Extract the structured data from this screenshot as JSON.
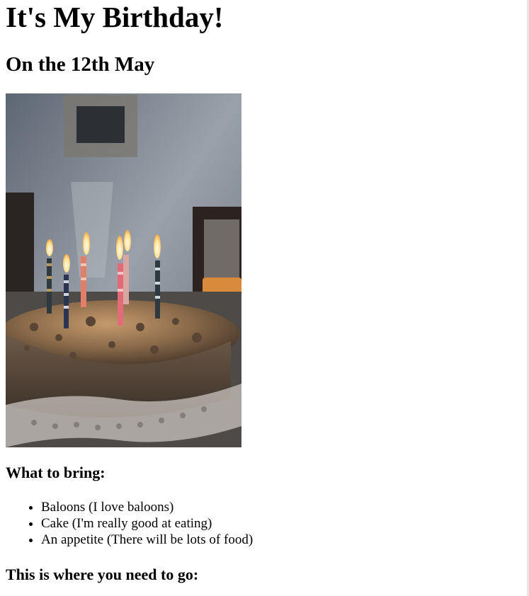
{
  "page": {
    "title": "It's My Birthday!",
    "date_heading": "On the 12th May",
    "image_alt": "Birthday cake with lit candles",
    "bring_heading": "What to bring:",
    "bring_items": [
      "Baloons (I love baloons)",
      "Cake (I'm really good at eating)",
      "An appetite (There will be lots of food)"
    ],
    "location_heading": "This is where you need to go:"
  },
  "colors": {
    "text": "#000000",
    "background": "#ffffff"
  }
}
